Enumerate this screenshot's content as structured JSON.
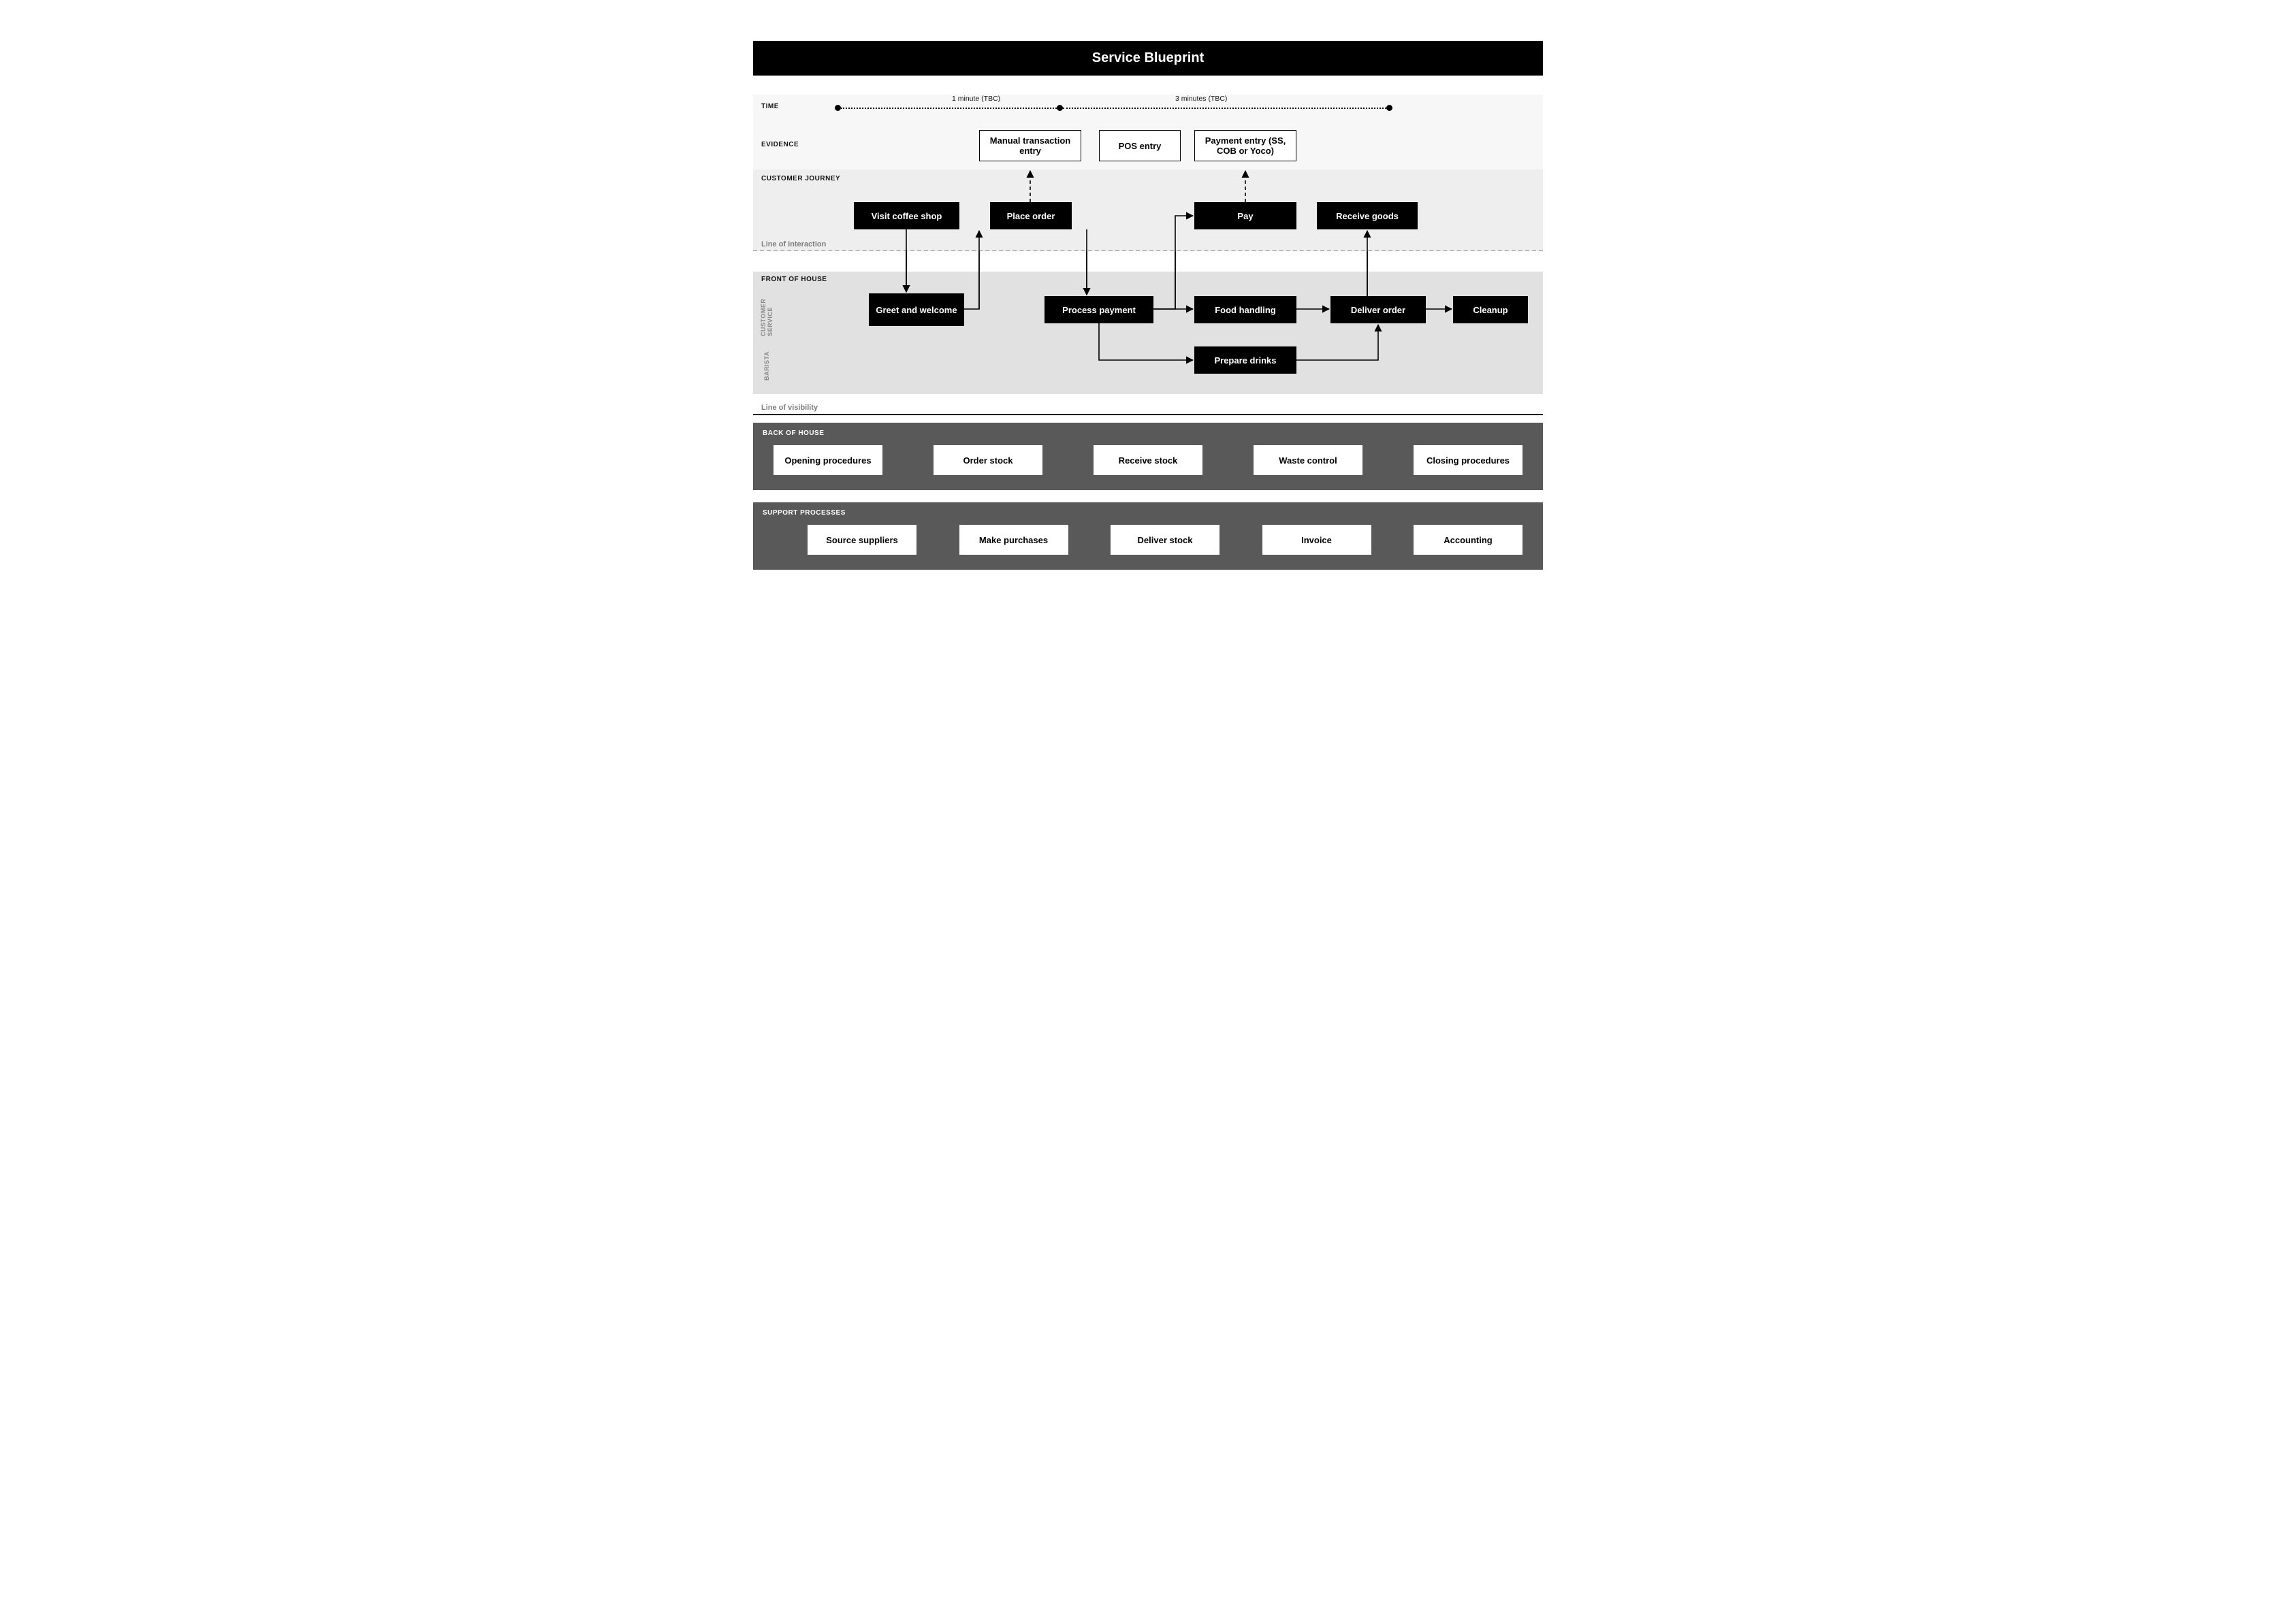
{
  "title": "Service Blueprint",
  "lanes": {
    "time": "TIME",
    "evidence": "EVIDENCE",
    "customer_journey": "CUSTOMER JOURNEY",
    "line_interaction": "Line of interaction",
    "front": "FRONT OF HOUSE",
    "sub_cs": "CUSTOMER\nSERVICE",
    "sub_barista": "BARISTA",
    "line_visibility": "Line of visibility",
    "back": "BACK OF HOUSE",
    "support": "SUPPORT PROCESSES"
  },
  "time": {
    "t1": "1 minute (TBC)",
    "t2": "3 minutes (TBC)"
  },
  "evidence": {
    "manual": "Manual transaction entry",
    "pos": "POS entry",
    "payment": "Payment entry (SS, COB or Yoco)"
  },
  "journey": {
    "visit": "Visit coffee shop",
    "place": "Place order",
    "pay": "Pay",
    "receive": "Receive goods"
  },
  "front": {
    "greet": "Greet and welcome",
    "process": "Process payment",
    "food": "Food handling",
    "deliver": "Deliver order",
    "cleanup": "Cleanup",
    "prepare": "Prepare drinks"
  },
  "back": {
    "b1": "Opening procedures",
    "b2": "Order stock",
    "b3": "Receive stock",
    "b4": "Waste control",
    "b5": "Closing procedures"
  },
  "support": {
    "s1": "Source suppliers",
    "s2": "Make purchases",
    "s3": "Deliver stock",
    "s4": "Invoice",
    "s5": "Accounting"
  }
}
